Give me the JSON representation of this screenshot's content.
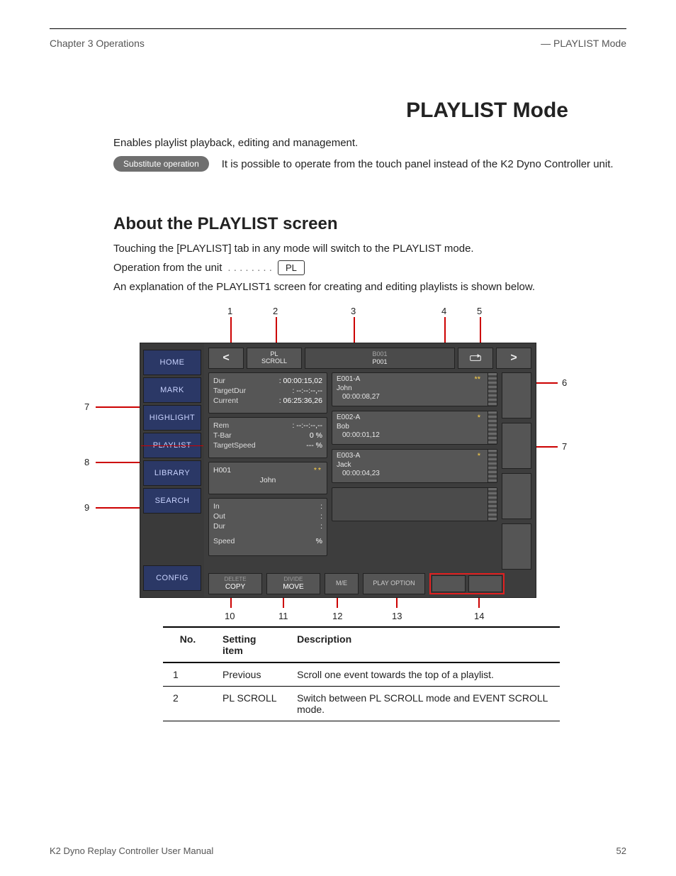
{
  "header": {
    "left": "Chapter 3 Operations",
    "right": "— PLAYLIST Mode"
  },
  "title": "PLAYLIST Mode",
  "intro": "Enables playlist playback, editing and management.",
  "substitute": {
    "pill": "Substitute operation",
    "text": "It is possible to operate from the touch panel instead of the K2 Dyno Controller unit."
  },
  "section": {
    "heading": "About the PLAYLIST screen",
    "p1": "Touching the [PLAYLIST] tab in any mode will switch to the PLAYLIST mode.",
    "op_lead": "Operation from the unit",
    "op_dots": ". . . . . . . .",
    "op_key": "PL",
    "p2": "An explanation of the PLAYLIST1 screen for creating and editing playlists is shown below."
  },
  "device": {
    "sidebar": [
      "HOME",
      "MARK",
      "HIGHLIGHT",
      "PLAYLIST",
      "LIBRARY",
      "SEARCH",
      "CONFIG"
    ],
    "topbar": {
      "prev": "<",
      "pl_scroll_l1": "PL",
      "pl_scroll_l2": "SCROLL",
      "playlist_id": "B001",
      "playlist_name": "P001",
      "next": ">"
    },
    "panel_dur": {
      "r1_label": "Dur",
      "r1_value": ": 00:00:15,02",
      "r2_label": "TargetDur",
      "r2_value": ": --:--:--,--",
      "r3_label": "Current",
      "r3_value": ": 06:25:36,26"
    },
    "panel_rem": {
      "r1_label": "Rem",
      "r1_value": ": --:--:--,--",
      "r2_label": "T-Bar",
      "r2_value": "0  %",
      "r3_label": "TargetSpeed",
      "r3_value": "---  %"
    },
    "panel_highlight": {
      "name": "H001",
      "stars": "**",
      "title": "John"
    },
    "panel_inout": {
      "r1_label": "In",
      "r1_value": ":",
      "r2_label": "Out",
      "r2_value": ":",
      "r3_label": "Dur",
      "r3_value": ":",
      "r4_label": "Speed",
      "r4_value": "%"
    },
    "events": [
      {
        "id": "E001-A",
        "stars": "**",
        "name": "John",
        "tc": "00:00:08,27"
      },
      {
        "id": "E002-A",
        "stars": "*",
        "name": "Bob",
        "tc": "00:00:01,12"
      },
      {
        "id": "E003-A",
        "stars": "*",
        "name": "Jack",
        "tc": "00:00:04,23"
      }
    ],
    "bottombar": {
      "b1_l1": "DELETE",
      "b1_l2": "COPY",
      "b2_l1": "DIVIDE",
      "b2_l2": "MOVE",
      "me": "M/E",
      "play": "PLAY OPTION"
    }
  },
  "callouts": {
    "c1": "1",
    "c2": "2",
    "c3": "3",
    "c4": "4",
    "c5": "5",
    "c6": "6",
    "c7": "7",
    "c8": "8",
    "c9": "9",
    "c10": "10",
    "c11": "11",
    "c12": "12",
    "c13": "13",
    "c14": "14"
  },
  "legend": {
    "head_no": "No.",
    "head_item": "Setting item",
    "head_desc": "Description",
    "rows": [
      {
        "no": "1",
        "item": "Previous",
        "desc": "Scroll one event towards the top of a playlist."
      },
      {
        "no": "2",
        "item": "PL SCROLL",
        "desc": "Switch between PL SCROLL mode and EVENT SCROLL mode."
      }
    ]
  },
  "footer": {
    "left": "K2 Dyno Replay Controller User Manual",
    "right": "52"
  }
}
